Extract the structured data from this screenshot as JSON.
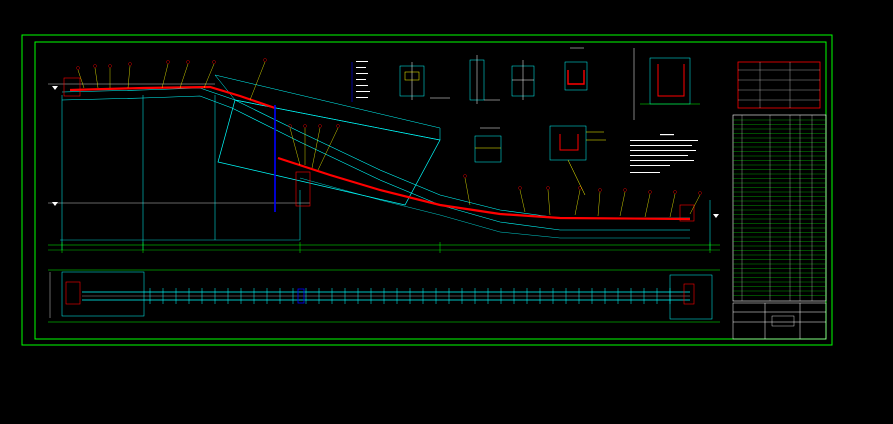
{
  "drawing": {
    "background_color": "#000000",
    "colors": {
      "frame": "#00ff00",
      "belt": "#ff0000",
      "structure": "#00ffff",
      "leaders": "#ffff00",
      "dimension": "#00ff00",
      "text": "#ffffff",
      "column": "#0000ff",
      "title_block": "#ffffff"
    },
    "views": [
      "conveyor-elevation",
      "conveyor-plan",
      "section-details",
      "title-block",
      "bill-of-materials-table",
      "technical-notes"
    ]
  }
}
